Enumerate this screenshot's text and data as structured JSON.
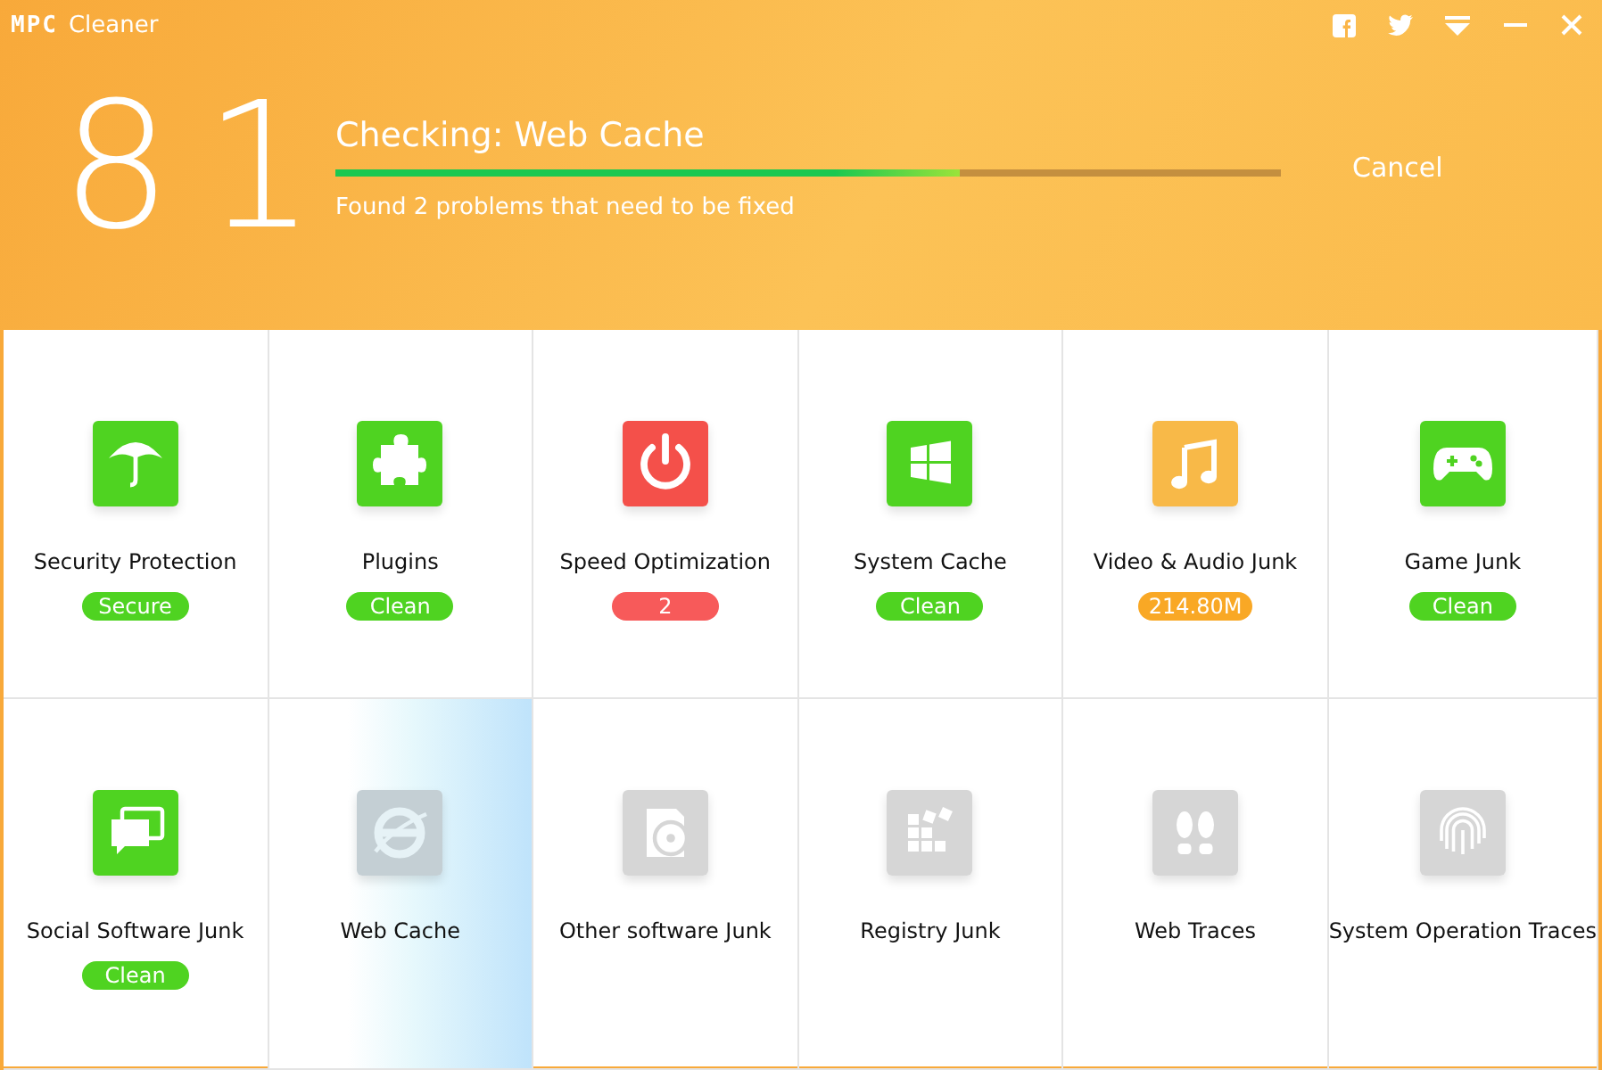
{
  "window": {
    "logo": "MPC",
    "title": "Cleaner"
  },
  "score": "81",
  "progress": {
    "title": "Checking: Web Cache",
    "level": 0.66,
    "message": "Found 2 problems that need to be fixed",
    "cancel": "Cancel"
  },
  "tiles": [
    {
      "label": "Security Protection",
      "kind": "umbrella",
      "color": "#4fd321",
      "scanning": false,
      "badge": {
        "text": "Secure",
        "color": "#4fd321"
      }
    },
    {
      "label": "Plugins",
      "kind": "puzzle",
      "color": "#4fd321",
      "scanning": false,
      "badge": {
        "text": "Clean",
        "color": "#4fd321"
      }
    },
    {
      "label": "Speed Optimization",
      "kind": "power",
      "color": "#f4504a",
      "scanning": false,
      "badge": {
        "text": "2",
        "color": "#f75a5a"
      }
    },
    {
      "label": "System Cache",
      "kind": "windows",
      "color": "#4fd321",
      "scanning": false,
      "badge": {
        "text": "Clean",
        "color": "#4fd321"
      }
    },
    {
      "label": "Video & Audio Junk",
      "kind": "music",
      "color": "#f8b948",
      "scanning": false,
      "badge": {
        "text": "214.80M",
        "color": "#f9a825"
      }
    },
    {
      "label": "Game Junk",
      "kind": "gamepad",
      "color": "#4fd321",
      "scanning": false,
      "badge": {
        "text": "Clean",
        "color": "#4fd321"
      }
    },
    {
      "label": "Social Software Junk",
      "kind": "chat",
      "color": "#4fd321",
      "scanning": false,
      "badge": {
        "text": "Clean",
        "color": "#4fd321"
      }
    },
    {
      "label": "Web Cache",
      "kind": "browser",
      "color": "#c4cfd4",
      "scanning": true
    },
    {
      "label": "Other software Junk",
      "kind": "disc",
      "color": "#d6d6d6",
      "scanning": false
    },
    {
      "label": "Registry Junk",
      "kind": "blocks",
      "color": "#d6d6d6",
      "scanning": false
    },
    {
      "label": "Web Traces",
      "kind": "footprints",
      "color": "#d6d6d6",
      "scanning": false
    },
    {
      "label": "System Operation Traces",
      "kind": "fingerprint",
      "color": "#d6d6d6",
      "scanning": false
    }
  ]
}
